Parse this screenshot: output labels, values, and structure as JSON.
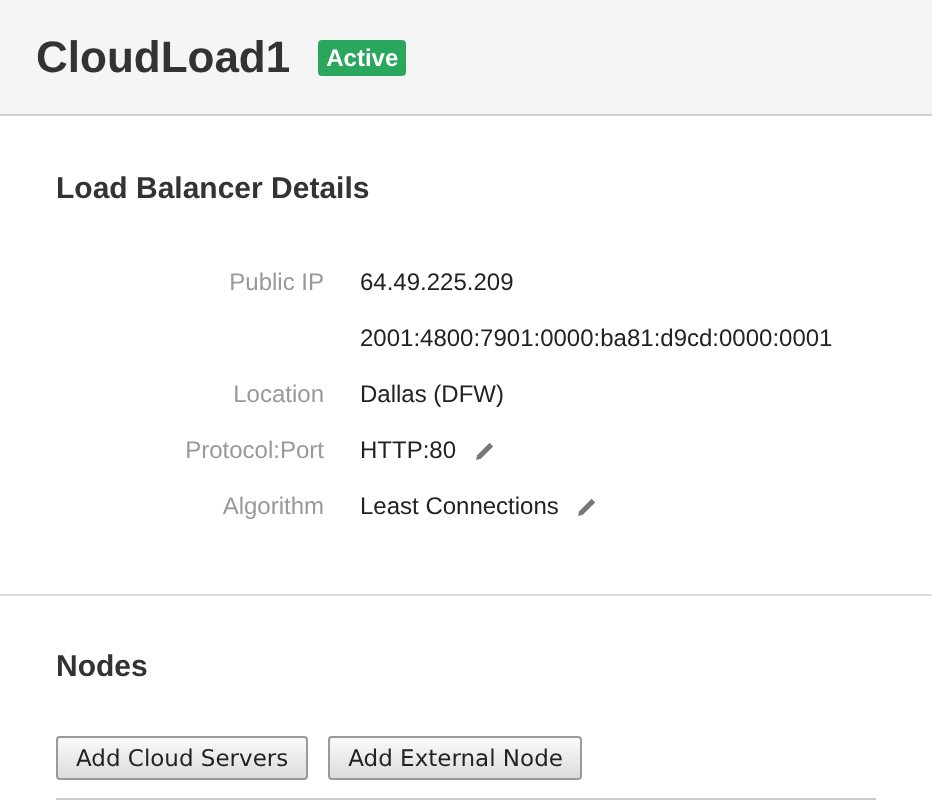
{
  "header": {
    "title": "CloudLoad1",
    "status": "Active"
  },
  "details": {
    "heading": "Load Balancer Details",
    "rows": [
      {
        "label": "Public IP",
        "values": [
          "64.49.225.209",
          "2001:4800:7901:0000:ba81:d9cd:0000:0001"
        ],
        "editable": false
      },
      {
        "label": "Location",
        "values": [
          "Dallas (DFW)"
        ],
        "editable": false
      },
      {
        "label": "Protocol:Port",
        "values": [
          "HTTP:80"
        ],
        "editable": true
      },
      {
        "label": "Algorithm",
        "values": [
          "Least Connections"
        ],
        "editable": true
      }
    ]
  },
  "nodes": {
    "heading": "Nodes",
    "buttons": [
      "Add Cloud Servers",
      "Add External Node"
    ]
  }
}
